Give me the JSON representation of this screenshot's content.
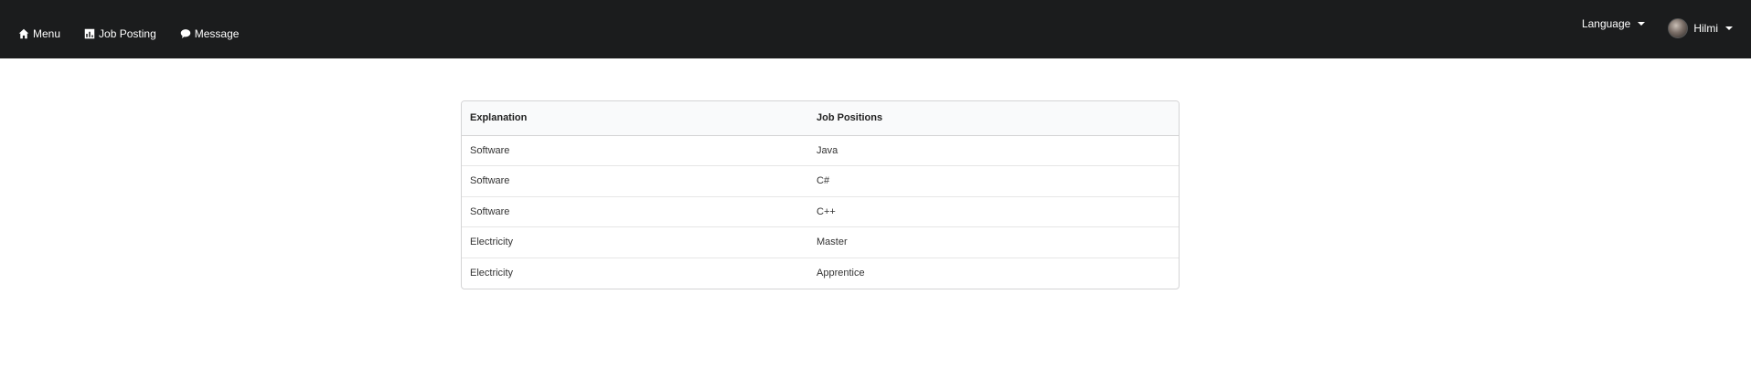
{
  "nav": {
    "items": [
      {
        "label": "Menu",
        "icon": "home-icon"
      },
      {
        "label": "Job Posting",
        "icon": "chart-icon"
      },
      {
        "label": "Message",
        "icon": "comment-icon"
      }
    ],
    "language_label": "Language",
    "user_name": "Hilmi"
  },
  "table": {
    "headers": [
      "Explanation",
      "Job Positions"
    ],
    "rows": [
      [
        "Software",
        "Java"
      ],
      [
        "Software",
        "C#"
      ],
      [
        "Software",
        "C++"
      ],
      [
        "Electricity",
        "Master"
      ],
      [
        "Electricity",
        "Apprentice"
      ]
    ]
  }
}
